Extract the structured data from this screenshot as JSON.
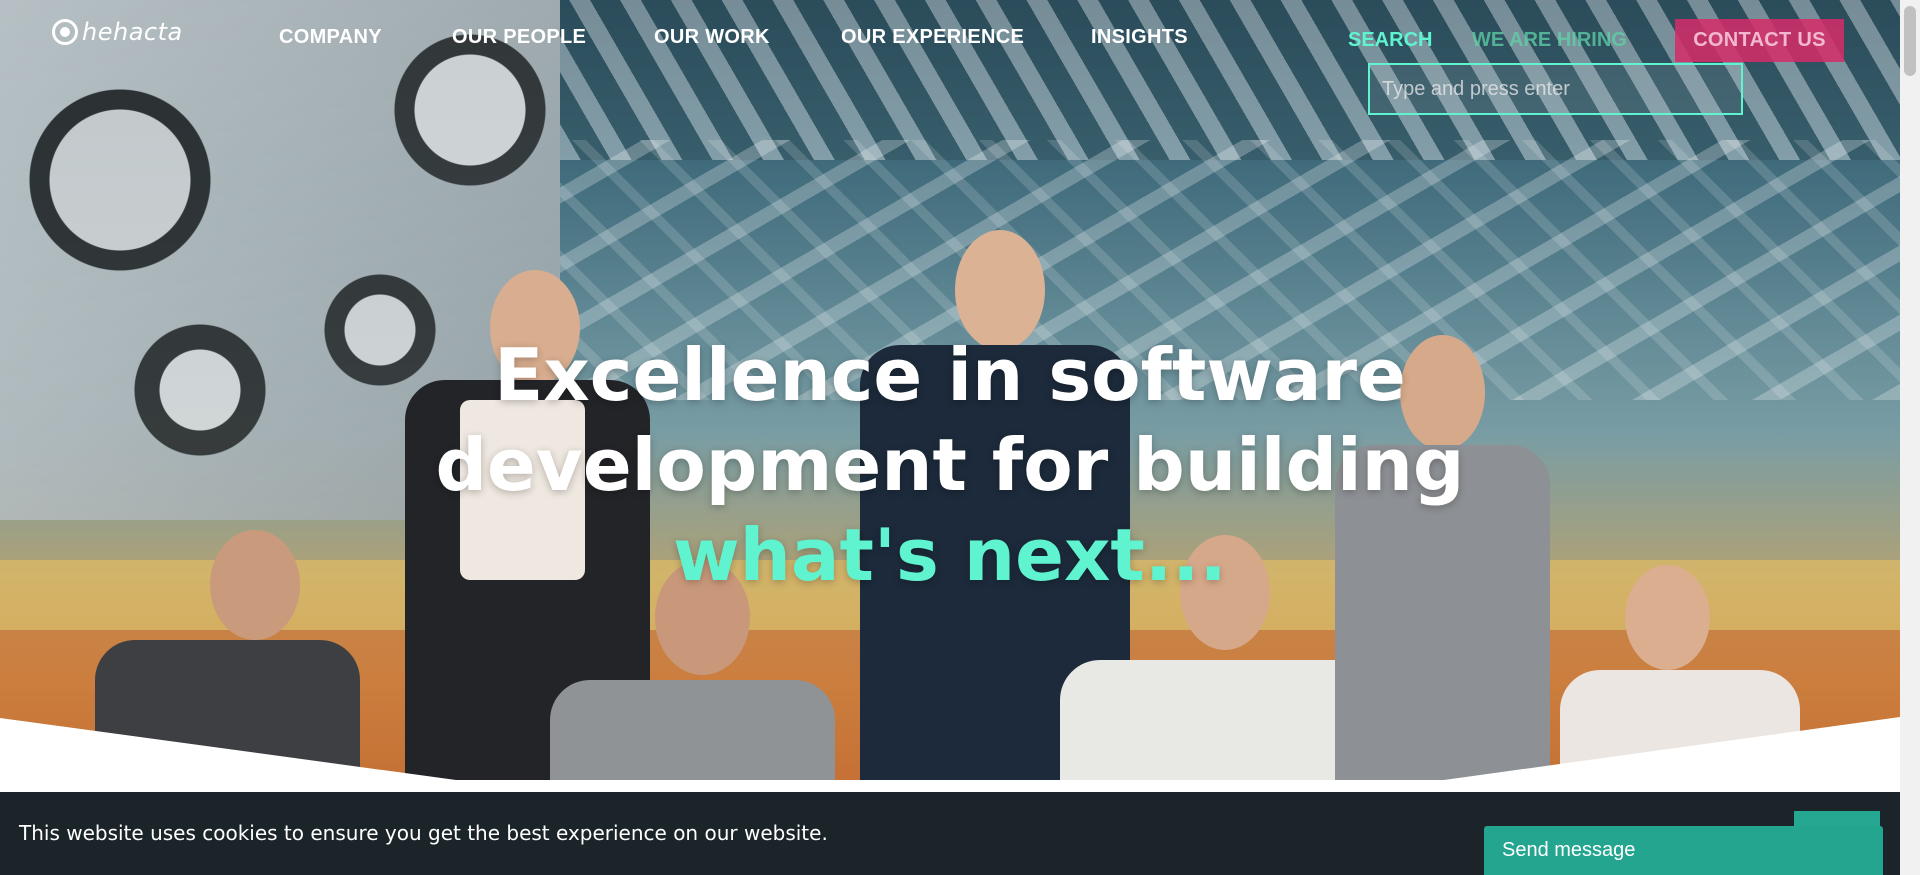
{
  "header": {
    "logo_text": "hehacta",
    "nav": [
      "COMPANY",
      "OUR PEOPLE",
      "OUR WORK",
      "OUR EXPERIENCE",
      "INSIGHTS"
    ],
    "search_label": "SEARCH",
    "hiring_label": "WE ARE HIRING",
    "contact_label": "CONTACT US",
    "search_placeholder": "Type and press enter"
  },
  "hero": {
    "line1": "Excellence in software",
    "line2": "development for building",
    "accent": "what's next..."
  },
  "cookie": {
    "text": "This website uses cookies to ensure you get the best experience on our website."
  },
  "chat": {
    "send_label": "Send message"
  },
  "colors": {
    "accent": "#5ff3d0",
    "contact": "#d62c68",
    "cookie_bg": "#1b2529",
    "chat": "#24a58f"
  }
}
